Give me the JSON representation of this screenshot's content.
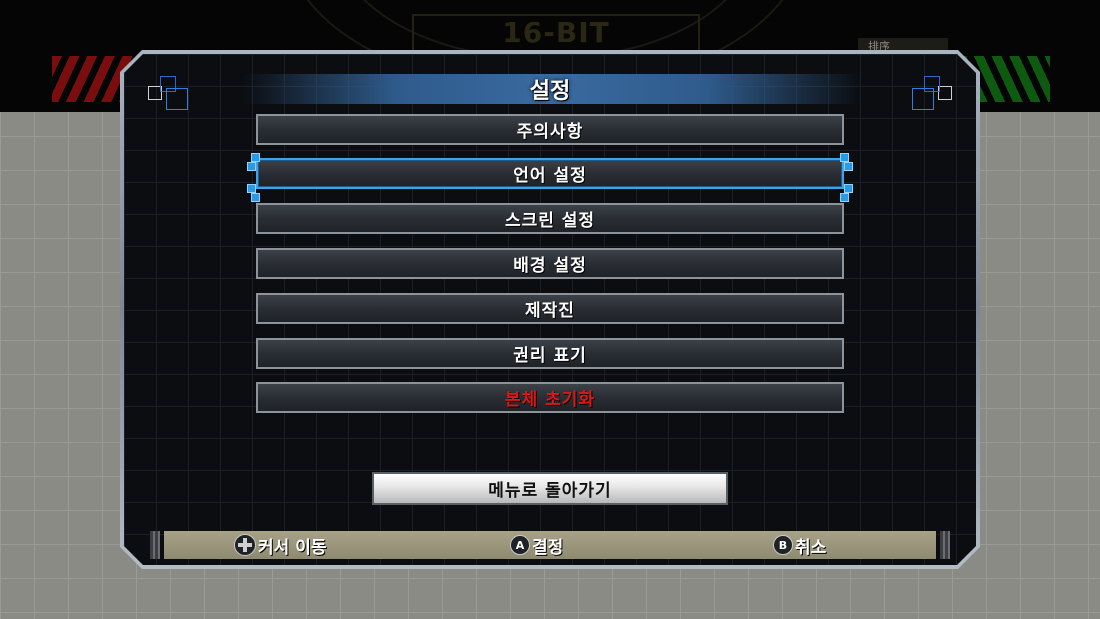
{
  "background": {
    "logo_text": "16-BIT",
    "side_label": "排序"
  },
  "dialog": {
    "title": "설정"
  },
  "menu": {
    "items": [
      {
        "label": "주의사항",
        "selected": false,
        "color": "#ffffff"
      },
      {
        "label": "언어 설정",
        "selected": true,
        "color": "#ffffff"
      },
      {
        "label": "스크린 설정",
        "selected": false,
        "color": "#ffffff"
      },
      {
        "label": "배경 설정",
        "selected": false,
        "color": "#ffffff"
      },
      {
        "label": "제작진",
        "selected": false,
        "color": "#ffffff"
      },
      {
        "label": "권리 표기",
        "selected": false,
        "color": "#ffffff"
      },
      {
        "label": "본체 초기화",
        "selected": false,
        "color": "#e01616"
      }
    ]
  },
  "back_button": {
    "label": "메뉴로 돌아가기"
  },
  "footer": {
    "move": {
      "icon": "dpad-icon",
      "label": "커서 이동"
    },
    "confirm": {
      "button": "A",
      "label": "결정"
    },
    "cancel": {
      "button": "B",
      "label": "취소"
    }
  },
  "colors": {
    "selection": "#3fa3e8",
    "title_bar": "#3a6aa0",
    "danger": "#e01616"
  }
}
